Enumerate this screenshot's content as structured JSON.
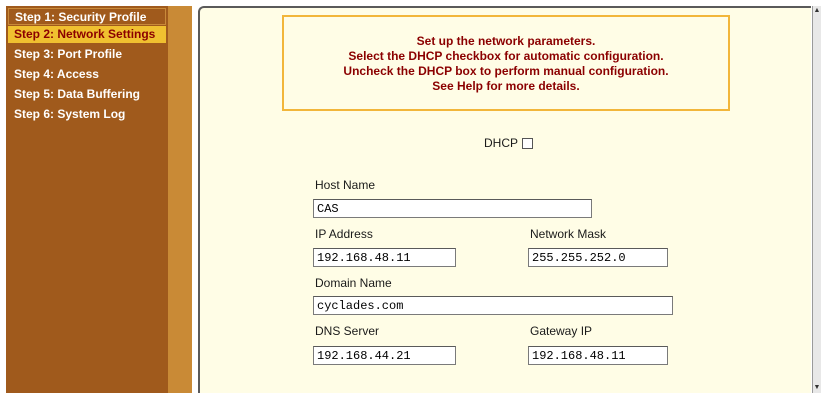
{
  "sidebar": {
    "items": [
      {
        "label": "Step 1: Security Profile"
      },
      {
        "label": "Step 2: Network Settings"
      },
      {
        "label": "Step 3: Port Profile"
      },
      {
        "label": "Step 4: Access"
      },
      {
        "label": "Step 5: Data Buffering"
      },
      {
        "label": "Step 6: System Log"
      }
    ],
    "active_index": 1
  },
  "info": {
    "lines": [
      "Set up the network parameters.",
      "Select the DHCP checkbox for automatic configuration.",
      "Uncheck the DHCP box to perform manual configuration.",
      "See Help for more details."
    ]
  },
  "form": {
    "dhcp_label": "DHCP",
    "dhcp_checked": false,
    "host_name": {
      "label": "Host Name",
      "value": "CAS"
    },
    "ip_address": {
      "label": "IP Address",
      "value": "192.168.48.11"
    },
    "network_mask": {
      "label": "Network Mask",
      "value": "255.255.252.0"
    },
    "domain_name": {
      "label": "Domain Name",
      "value": "cyclades.com"
    },
    "dns_server": {
      "label": "DNS Server",
      "value": "192.168.44.21"
    },
    "gateway_ip": {
      "label": "Gateway IP",
      "value": "192.168.48.11"
    }
  },
  "colors": {
    "sidebar_bg": "#a05a1c",
    "sidebar_active_bg": "#f0c030",
    "sidebar_active_text": "#8b0000",
    "panel_bg": "#fffde6",
    "info_border": "#f2b63a",
    "info_text": "#8b0000"
  }
}
